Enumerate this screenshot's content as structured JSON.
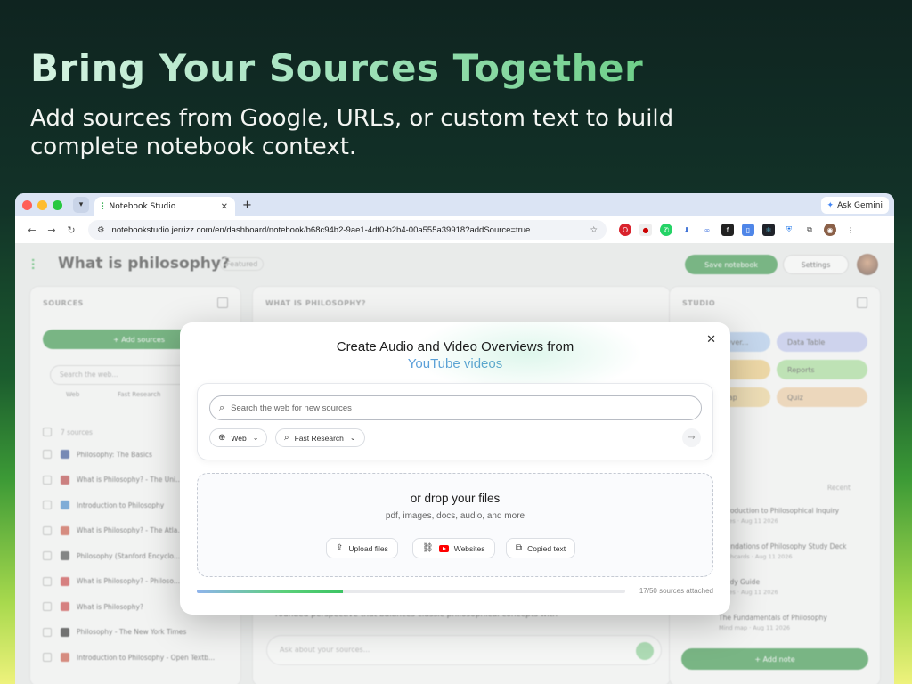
{
  "hero": {
    "title": "Bring Your Sources Together",
    "subtitle": "Add sources from Google, URLs, or custom text to build complete notebook context."
  },
  "browser": {
    "tab_title": "Notebook Studio",
    "new_tab": "+",
    "ask_gemini": "Ask Gemini",
    "url": "notebookstudio.jerrizz.com/en/dashboard/notebook/b68c94b2-9ae1-4df0-b2b4-00a555a39918?addSource=true",
    "colors": {
      "close": "#ff5f57",
      "minimize": "#febc2e",
      "maximize": "#28c840"
    }
  },
  "app": {
    "notebook_title": "What is philosophy?",
    "featured_label": "Featured",
    "save_notebook": "Save notebook",
    "settings": "Settings",
    "sources_panel": {
      "heading": "SOURCES",
      "add_sources": "+ Add sources",
      "search_placeholder": "Search the web...",
      "web_chip": "Web",
      "research_chip": "Fast Research",
      "select_all": "7 sources",
      "items": [
        {
          "label": "Philosophy: The Basics",
          "color": "#1a3a8a"
        },
        {
          "label": "What is Philosophy? - The Uni...",
          "color": "#b32a2a"
        },
        {
          "label": "Introduction to Philosophy",
          "color": "#2a7ac8"
        },
        {
          "label": "What is Philosophy? - The Atla...",
          "color": "#c8402a"
        },
        {
          "label": "Philosophy (Stanford Encyclo...",
          "color": "#333333"
        },
        {
          "label": "What is Philosophy? - Philoso...",
          "color": "#c82a2a"
        },
        {
          "label": "What is Philosophy?",
          "color": "#c82a2a"
        },
        {
          "label": "Philosophy - The New York Times",
          "color": "#111111"
        },
        {
          "label": "Introduction to Philosophy - Open Textb...",
          "color": "#c8402a"
        }
      ]
    },
    "chat_panel": {
      "heading": "WHAT IS PHILOSOPHY?",
      "visible_text": "rounded perspective that balances classic philosophical concepts with",
      "input_placeholder": "Ask about your sources..."
    },
    "studio_panel": {
      "heading": "STUDIO",
      "chips": [
        "Audio Over...",
        "Data Table",
        "Video",
        "Reports",
        "Mind Map",
        "Quiz"
      ],
      "sort_label": "Recent",
      "notes": [
        {
          "title": "Introduction to Philosophical Inquiry",
          "meta": "Notes · Aug 11 2026"
        },
        {
          "title": "Foundations of Philosophy Study Deck",
          "meta": "Flashcards · Aug 11 2026"
        },
        {
          "title": "Study Guide",
          "meta": "Notes · Aug 11 2026"
        },
        {
          "title": "The Fundamentals of Philosophy",
          "meta": "Mind map · Aug 11 2026"
        }
      ],
      "add_note": "+ Add note"
    }
  },
  "modal": {
    "title": "Create Audio and Video Overviews from",
    "subtitle": "YouTube videos",
    "search_placeholder": "Search the web for new sources",
    "web_label": "Web",
    "research_label": "Fast Research",
    "drop_title": "or drop your files",
    "drop_subtitle": "pdf, images, docs, audio, and more",
    "upload_label": "Upload files",
    "websites_label": "Websites",
    "copied_text_label": "Copied text",
    "progress_fraction": 0.34,
    "progress_label": "17/50 sources attached"
  },
  "colors": {
    "accent_green": "#1e8a32",
    "youtube_red": "#ff0000"
  }
}
